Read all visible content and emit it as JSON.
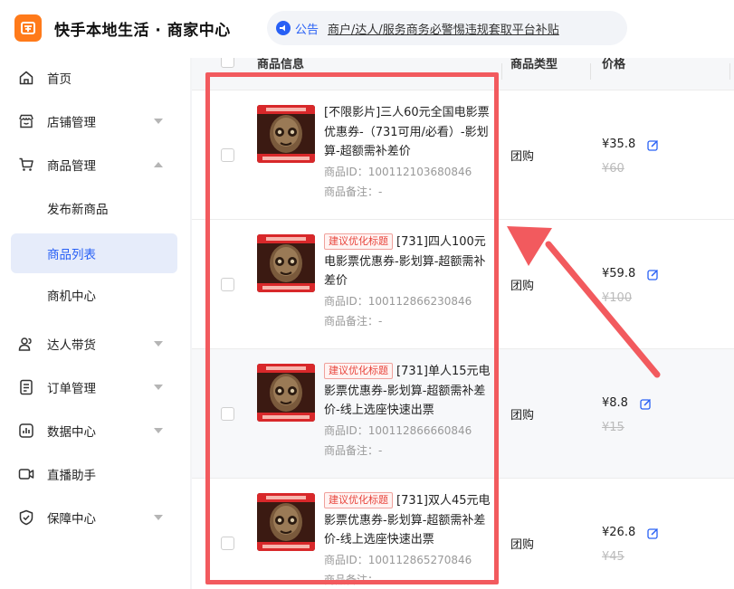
{
  "header": {
    "app_title": "快手本地生活 · 商家中心",
    "notice_label": "公告",
    "notice_text": "商户/达人/服务商务必警惕违规套取平台补贴"
  },
  "sidebar": {
    "items": [
      {
        "label": "首页",
        "icon": "home-icon"
      },
      {
        "label": "店铺管理",
        "icon": "store-icon",
        "expandable": true
      },
      {
        "label": "商品管理",
        "icon": "cart-icon",
        "expandable": true,
        "expanded": true
      },
      {
        "label": "发布新商品",
        "sub": true
      },
      {
        "label": "商品列表",
        "sub": true,
        "active": true
      },
      {
        "label": "商机中心",
        "sub": true
      },
      {
        "label": "达人带货",
        "icon": "people-icon",
        "expandable": true
      },
      {
        "label": "订单管理",
        "icon": "order-icon",
        "expandable": true
      },
      {
        "label": "数据中心",
        "icon": "chart-icon",
        "expandable": true
      },
      {
        "label": "直播助手",
        "icon": "video-icon"
      },
      {
        "label": "保障中心",
        "icon": "shield-icon",
        "expandable": true
      }
    ]
  },
  "table": {
    "headers": {
      "info": "商品信息",
      "type": "商品类型",
      "price": "价格"
    },
    "rows": [
      {
        "tag": "",
        "title": "[不限影片]三人60元全国电影票优惠券-（731可用/必看）-影划算-超额需补差价",
        "id_line": "商品ID：100112103680846",
        "note_line": "商品备注：-",
        "type": "团购",
        "price": "¥35.8",
        "orig": "¥60"
      },
      {
        "tag": "建议优化标题",
        "title": "[731]四人100元电影票优惠券-影划算-超额需补差价",
        "id_line": "商品ID：100112866230846",
        "note_line": "商品备注：-",
        "type": "团购",
        "price": "¥59.8",
        "orig": "¥100"
      },
      {
        "tag": "建议优化标题",
        "title": "[731]单人15元电影票优惠券-影划算-超额需补差价-线上选座快速出票",
        "id_line": "商品ID：100112866660846",
        "note_line": "商品备注：-",
        "type": "团购",
        "price": "¥8.8",
        "orig": "¥15"
      },
      {
        "tag": "建议优化标题",
        "title": "[731]双人45元电影票优惠券-影划算-超额需补差价-线上选座快速出票",
        "id_line": "商品ID：100112865270846",
        "note_line": "商品备注：-",
        "type": "团购",
        "price": "¥26.8",
        "orig": "¥45"
      }
    ]
  },
  "colors": {
    "accent": "#2860f5",
    "logo": "#ff7a1a",
    "annotation": "#f25a5e",
    "tag_red": "#e8453c"
  }
}
